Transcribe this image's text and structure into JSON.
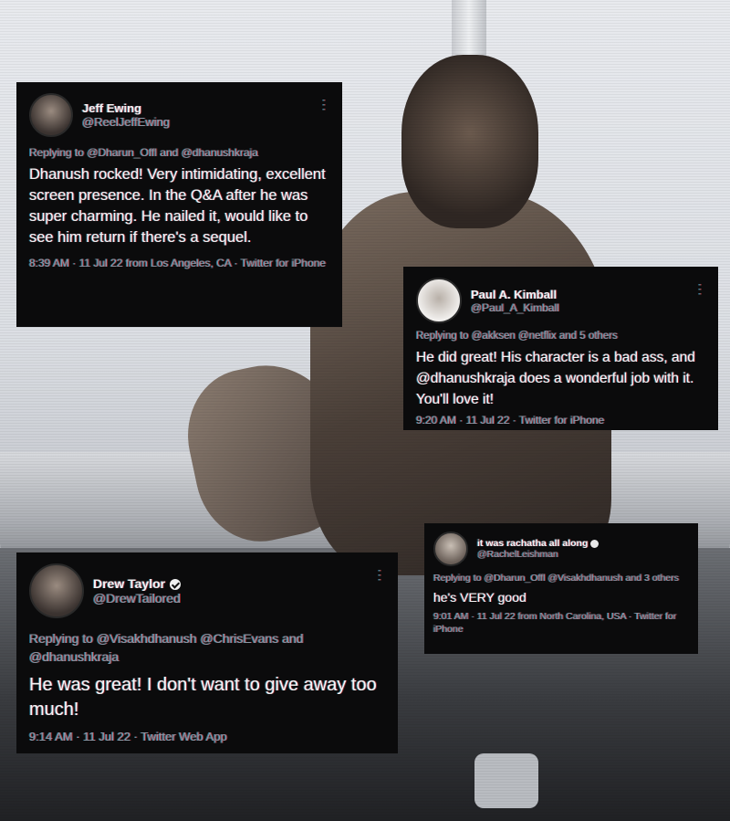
{
  "tweets": [
    {
      "name": "Jeff Ewing",
      "handle": "@ReelJeffEwing",
      "reply_prefix": "Replying to",
      "reply_to": "@Dharun_Offl and @dhanushkraja",
      "text": "Dhanush rocked! Very intimidating, excellent screen presence. In the Q&A after he was super charming. He nailed it, would like to see him return if there's a sequel.",
      "time": "8:39 AM",
      "date": "11 Jul 22",
      "location": "from Los Angeles, CA",
      "source": "Twitter for iPhone",
      "verified": false
    },
    {
      "name": "Paul A. Kimball",
      "handle": "@Paul_A_Kimball",
      "reply_prefix": "Replying to",
      "reply_to": "@akksen @netflix and 5 others",
      "text": "He did great! His character is a bad ass, and @dhanushkraja does a wonderful job with it. You'll love it!",
      "time": "9:20 AM",
      "date": "11 Jul 22",
      "source": "Twitter for iPhone",
      "verified": false
    },
    {
      "name": "Drew Taylor",
      "handle": "@DrewTailored",
      "reply_prefix": "Replying to",
      "reply_to": "@Visakhdhanush @ChrisEvans and @dhanushkraja",
      "text": "He was great! I don't want to give away too much!",
      "time": "9:14 AM",
      "date": "11 Jul 22",
      "source": "Twitter Web App",
      "verified": true
    },
    {
      "name": "it was rachatha all along",
      "handle": "@RachelLeishman",
      "reply_prefix": "Replying to",
      "reply_to": "@Dharun_Offl @Visakhdhanush and 3 others",
      "text": "he's VERY good",
      "time": "9:01 AM",
      "date": "11 Jul 22",
      "location": "from North Carolina, USA",
      "source": "Twitter for iPhone",
      "verified": false
    }
  ],
  "icons": {
    "more": "more-dots-icon",
    "verified": "verified-badge-icon"
  },
  "colors": {
    "card_bg": "#0b0b0c",
    "text": "#e7e9ea",
    "muted": "#8b98a5"
  }
}
